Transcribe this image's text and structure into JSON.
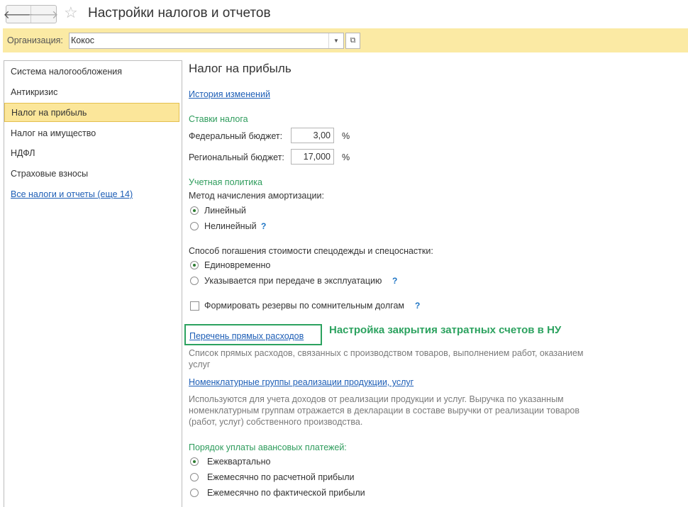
{
  "header": {
    "back_icon": "arrow-left-icon",
    "forward_icon": "arrow-right-icon",
    "favorite_icon": "star-icon",
    "title": "Настройки налогов и отчетов"
  },
  "org": {
    "label": "Организация:",
    "value": "Кокос",
    "dropdown_icon": "triangle-down-icon",
    "open_icon": "open-window-icon"
  },
  "sidebar": {
    "items": [
      {
        "label": "Система налогообложения"
      },
      {
        "label": "Антикризис"
      },
      {
        "label": "Налог на прибыль"
      },
      {
        "label": "Налог на имущество"
      },
      {
        "label": "НДФЛ"
      },
      {
        "label": "Страховые взносы"
      }
    ],
    "all_link": "Все налоги и отчеты (еще 14)"
  },
  "main": {
    "heading": "Налог на прибыль",
    "history_link": "История изменений",
    "rates_title": "Ставки налога",
    "federal_label": "Федеральный бюджет:",
    "federal_value": "3,00",
    "regional_label": "Региональный бюджет:",
    "regional_value": "17,000",
    "percent": "%",
    "policy_title": "Учетная политика",
    "amort_label": "Метод начисления амортизации:",
    "amort_options": [
      "Линейный",
      "Нелинейный"
    ],
    "amort_selected": 0,
    "workwear_label": "Способ погашения стоимости спецодежды и спецоснастки:",
    "workwear_options": [
      "Единовременно",
      "Указывается при передаче в эксплуатацию"
    ],
    "workwear_selected": 0,
    "reserves_label": "Формировать резервы по сомнительным долгам",
    "reserves_checked": false,
    "help_mark": "?",
    "direct_costs_link": "Перечень прямых расходов",
    "annotation": "Настройка закрытия затратных счетов в НУ",
    "direct_costs_hint": "Список прямых расходов, связанных с производством товаров, выполнением работ, оказанием услуг",
    "nomen_link": "Номенклатурные группы реализации продукции, услуг",
    "nomen_hint": "Используются для учета доходов от реализации продукции и услуг. Выручка по указанным номенклатурным группам отражается в декларации в составе выручки от реализации товаров (работ, услуг) собственного производства.",
    "advance_label": "Порядок уплаты авансовых платежей:",
    "advance_options": [
      "Ежеквартально",
      "Ежемесячно по расчетной прибыли",
      "Ежемесячно по фактической прибыли"
    ],
    "advance_selected": 0
  },
  "colors": {
    "accent_green": "#2e9c5c",
    "link_blue": "#1d5eb6",
    "org_bar": "#fbeaa4",
    "active_item": "#fbe69a"
  }
}
